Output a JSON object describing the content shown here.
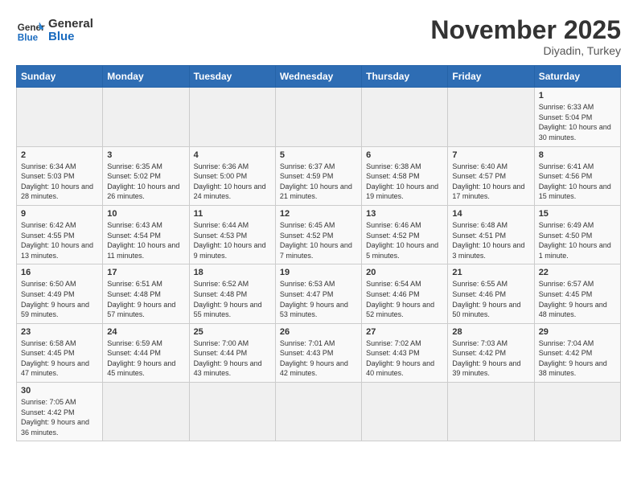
{
  "header": {
    "logo_general": "General",
    "logo_blue": "Blue",
    "title": "November 2025",
    "subtitle": "Diyadin, Turkey"
  },
  "days_of_week": [
    "Sunday",
    "Monday",
    "Tuesday",
    "Wednesday",
    "Thursday",
    "Friday",
    "Saturday"
  ],
  "weeks": [
    [
      {
        "day": "",
        "info": ""
      },
      {
        "day": "",
        "info": ""
      },
      {
        "day": "",
        "info": ""
      },
      {
        "day": "",
        "info": ""
      },
      {
        "day": "",
        "info": ""
      },
      {
        "day": "",
        "info": ""
      },
      {
        "day": "1",
        "info": "Sunrise: 6:33 AM\nSunset: 5:04 PM\nDaylight: 10 hours and 30 minutes."
      }
    ],
    [
      {
        "day": "2",
        "info": "Sunrise: 6:34 AM\nSunset: 5:03 PM\nDaylight: 10 hours and 28 minutes."
      },
      {
        "day": "3",
        "info": "Sunrise: 6:35 AM\nSunset: 5:02 PM\nDaylight: 10 hours and 26 minutes."
      },
      {
        "day": "4",
        "info": "Sunrise: 6:36 AM\nSunset: 5:00 PM\nDaylight: 10 hours and 24 minutes."
      },
      {
        "day": "5",
        "info": "Sunrise: 6:37 AM\nSunset: 4:59 PM\nDaylight: 10 hours and 21 minutes."
      },
      {
        "day": "6",
        "info": "Sunrise: 6:38 AM\nSunset: 4:58 PM\nDaylight: 10 hours and 19 minutes."
      },
      {
        "day": "7",
        "info": "Sunrise: 6:40 AM\nSunset: 4:57 PM\nDaylight: 10 hours and 17 minutes."
      },
      {
        "day": "8",
        "info": "Sunrise: 6:41 AM\nSunset: 4:56 PM\nDaylight: 10 hours and 15 minutes."
      }
    ],
    [
      {
        "day": "9",
        "info": "Sunrise: 6:42 AM\nSunset: 4:55 PM\nDaylight: 10 hours and 13 minutes."
      },
      {
        "day": "10",
        "info": "Sunrise: 6:43 AM\nSunset: 4:54 PM\nDaylight: 10 hours and 11 minutes."
      },
      {
        "day": "11",
        "info": "Sunrise: 6:44 AM\nSunset: 4:53 PM\nDaylight: 10 hours and 9 minutes."
      },
      {
        "day": "12",
        "info": "Sunrise: 6:45 AM\nSunset: 4:52 PM\nDaylight: 10 hours and 7 minutes."
      },
      {
        "day": "13",
        "info": "Sunrise: 6:46 AM\nSunset: 4:52 PM\nDaylight: 10 hours and 5 minutes."
      },
      {
        "day": "14",
        "info": "Sunrise: 6:48 AM\nSunset: 4:51 PM\nDaylight: 10 hours and 3 minutes."
      },
      {
        "day": "15",
        "info": "Sunrise: 6:49 AM\nSunset: 4:50 PM\nDaylight: 10 hours and 1 minute."
      }
    ],
    [
      {
        "day": "16",
        "info": "Sunrise: 6:50 AM\nSunset: 4:49 PM\nDaylight: 9 hours and 59 minutes."
      },
      {
        "day": "17",
        "info": "Sunrise: 6:51 AM\nSunset: 4:48 PM\nDaylight: 9 hours and 57 minutes."
      },
      {
        "day": "18",
        "info": "Sunrise: 6:52 AM\nSunset: 4:48 PM\nDaylight: 9 hours and 55 minutes."
      },
      {
        "day": "19",
        "info": "Sunrise: 6:53 AM\nSunset: 4:47 PM\nDaylight: 9 hours and 53 minutes."
      },
      {
        "day": "20",
        "info": "Sunrise: 6:54 AM\nSunset: 4:46 PM\nDaylight: 9 hours and 52 minutes."
      },
      {
        "day": "21",
        "info": "Sunrise: 6:55 AM\nSunset: 4:46 PM\nDaylight: 9 hours and 50 minutes."
      },
      {
        "day": "22",
        "info": "Sunrise: 6:57 AM\nSunset: 4:45 PM\nDaylight: 9 hours and 48 minutes."
      }
    ],
    [
      {
        "day": "23",
        "info": "Sunrise: 6:58 AM\nSunset: 4:45 PM\nDaylight: 9 hours and 47 minutes."
      },
      {
        "day": "24",
        "info": "Sunrise: 6:59 AM\nSunset: 4:44 PM\nDaylight: 9 hours and 45 minutes."
      },
      {
        "day": "25",
        "info": "Sunrise: 7:00 AM\nSunset: 4:44 PM\nDaylight: 9 hours and 43 minutes."
      },
      {
        "day": "26",
        "info": "Sunrise: 7:01 AM\nSunset: 4:43 PM\nDaylight: 9 hours and 42 minutes."
      },
      {
        "day": "27",
        "info": "Sunrise: 7:02 AM\nSunset: 4:43 PM\nDaylight: 9 hours and 40 minutes."
      },
      {
        "day": "28",
        "info": "Sunrise: 7:03 AM\nSunset: 4:42 PM\nDaylight: 9 hours and 39 minutes."
      },
      {
        "day": "29",
        "info": "Sunrise: 7:04 AM\nSunset: 4:42 PM\nDaylight: 9 hours and 38 minutes."
      }
    ],
    [
      {
        "day": "30",
        "info": "Sunrise: 7:05 AM\nSunset: 4:42 PM\nDaylight: 9 hours and 36 minutes."
      },
      {
        "day": "",
        "info": ""
      },
      {
        "day": "",
        "info": ""
      },
      {
        "day": "",
        "info": ""
      },
      {
        "day": "",
        "info": ""
      },
      {
        "day": "",
        "info": ""
      },
      {
        "day": "",
        "info": ""
      }
    ]
  ]
}
